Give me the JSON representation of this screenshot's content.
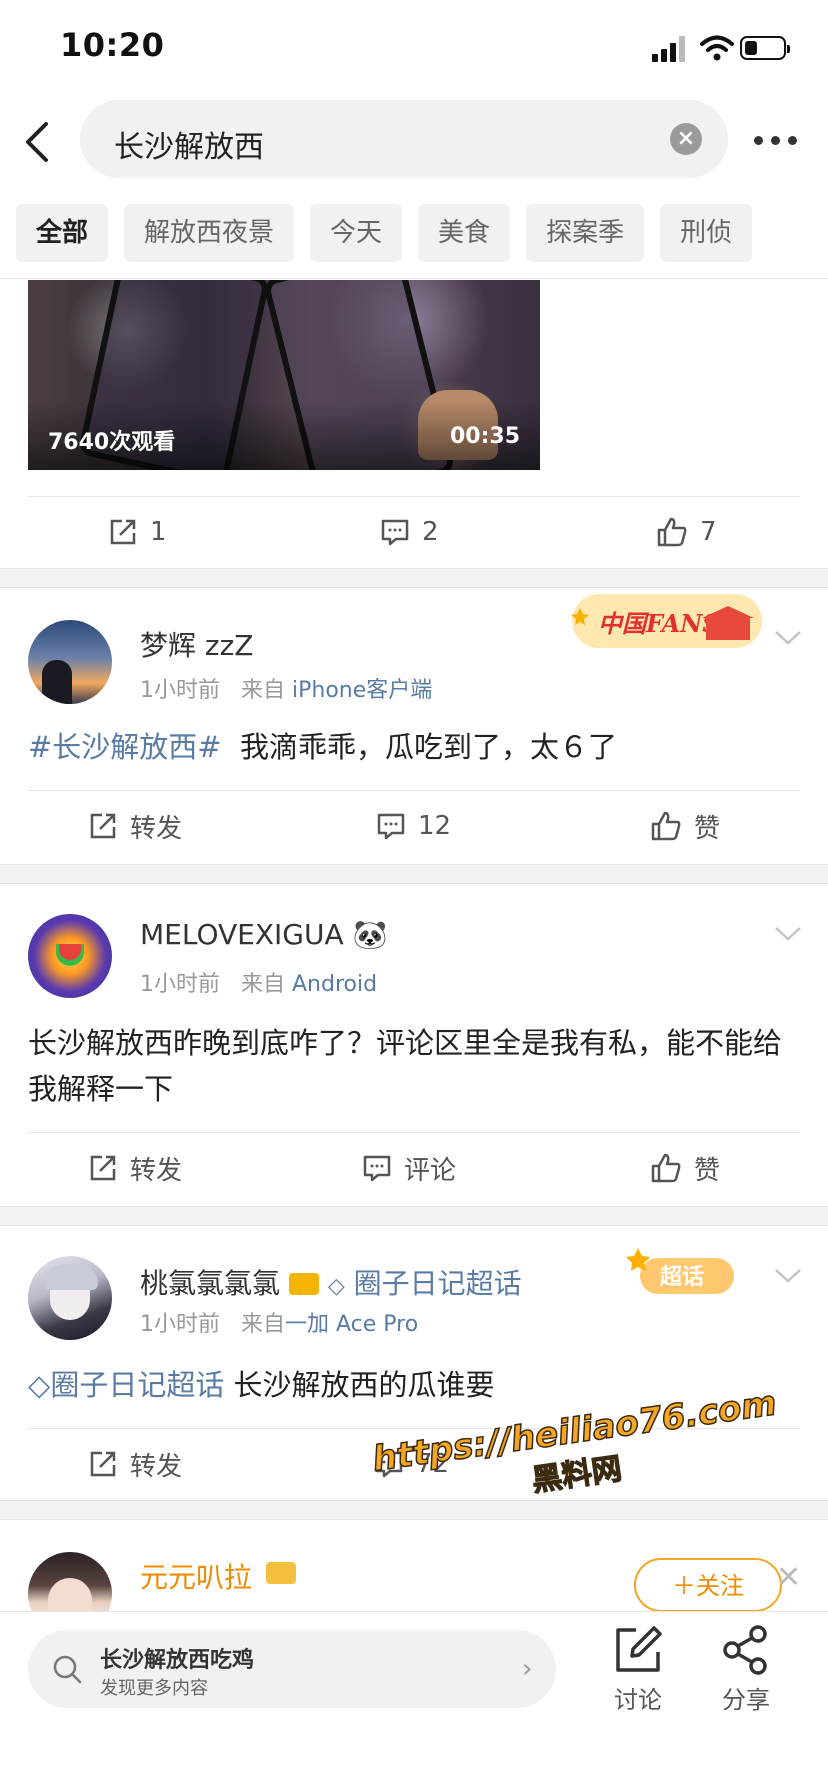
{
  "status_bar": {
    "time": "10:20"
  },
  "search": {
    "query": "长沙解放西"
  },
  "filter_tabs": [
    "全部",
    "解放西夜景",
    "今天",
    "美食",
    "探案季",
    "刑侦"
  ],
  "video_post": {
    "views": "7640次观看",
    "duration": "00:35",
    "actions": {
      "repost": "1",
      "comment": "2",
      "like": "7"
    }
  },
  "posts": [
    {
      "username": "梦辉 zzZ",
      "time": "1小时前",
      "from_prefix": "来自",
      "source": "iPhone客户端",
      "badge": "中国FANS",
      "topic": "#长沙解放西#",
      "text": "我滴乖乖，瓜吃到了，太６了",
      "actions": {
        "repost": "转发",
        "comment": "12",
        "like": "赞"
      }
    },
    {
      "username": "MELOVEXIGUA",
      "emoji": "🐼",
      "time": "1小时前",
      "from_prefix": "来自",
      "source": "Android",
      "text": "长沙解放西昨晚到底咋了？评论区里全是我有私，能不能给我解释一下",
      "actions": {
        "repost": "转发",
        "comment": "评论",
        "like": "赞"
      }
    },
    {
      "username": "桃氯氯氯氯",
      "supertopic": "圈子日记超话",
      "time": "1小时前",
      "from_prefix": "来自",
      "source": "一加 Ace Pro",
      "badge": "超话",
      "topic": "圈子日记超话",
      "text": "长沙解放西的瓜谁要",
      "actions": {
        "repost": "转发",
        "comment": "72",
        "like": ""
      }
    },
    {
      "username": "元元叭拉",
      "follow_label": "＋关注"
    }
  ],
  "watermark": {
    "line1": "https://heiliao76.com",
    "line2": "黑料网"
  },
  "bottom_bar": {
    "search_title": "长沙解放西吃鸡",
    "search_sub": "发现更多内容",
    "discuss": "讨论",
    "share": "分享"
  },
  "colors": {
    "link": "#5a7ba4",
    "orange": "#f08a00",
    "gap": "#f2f2f2"
  }
}
